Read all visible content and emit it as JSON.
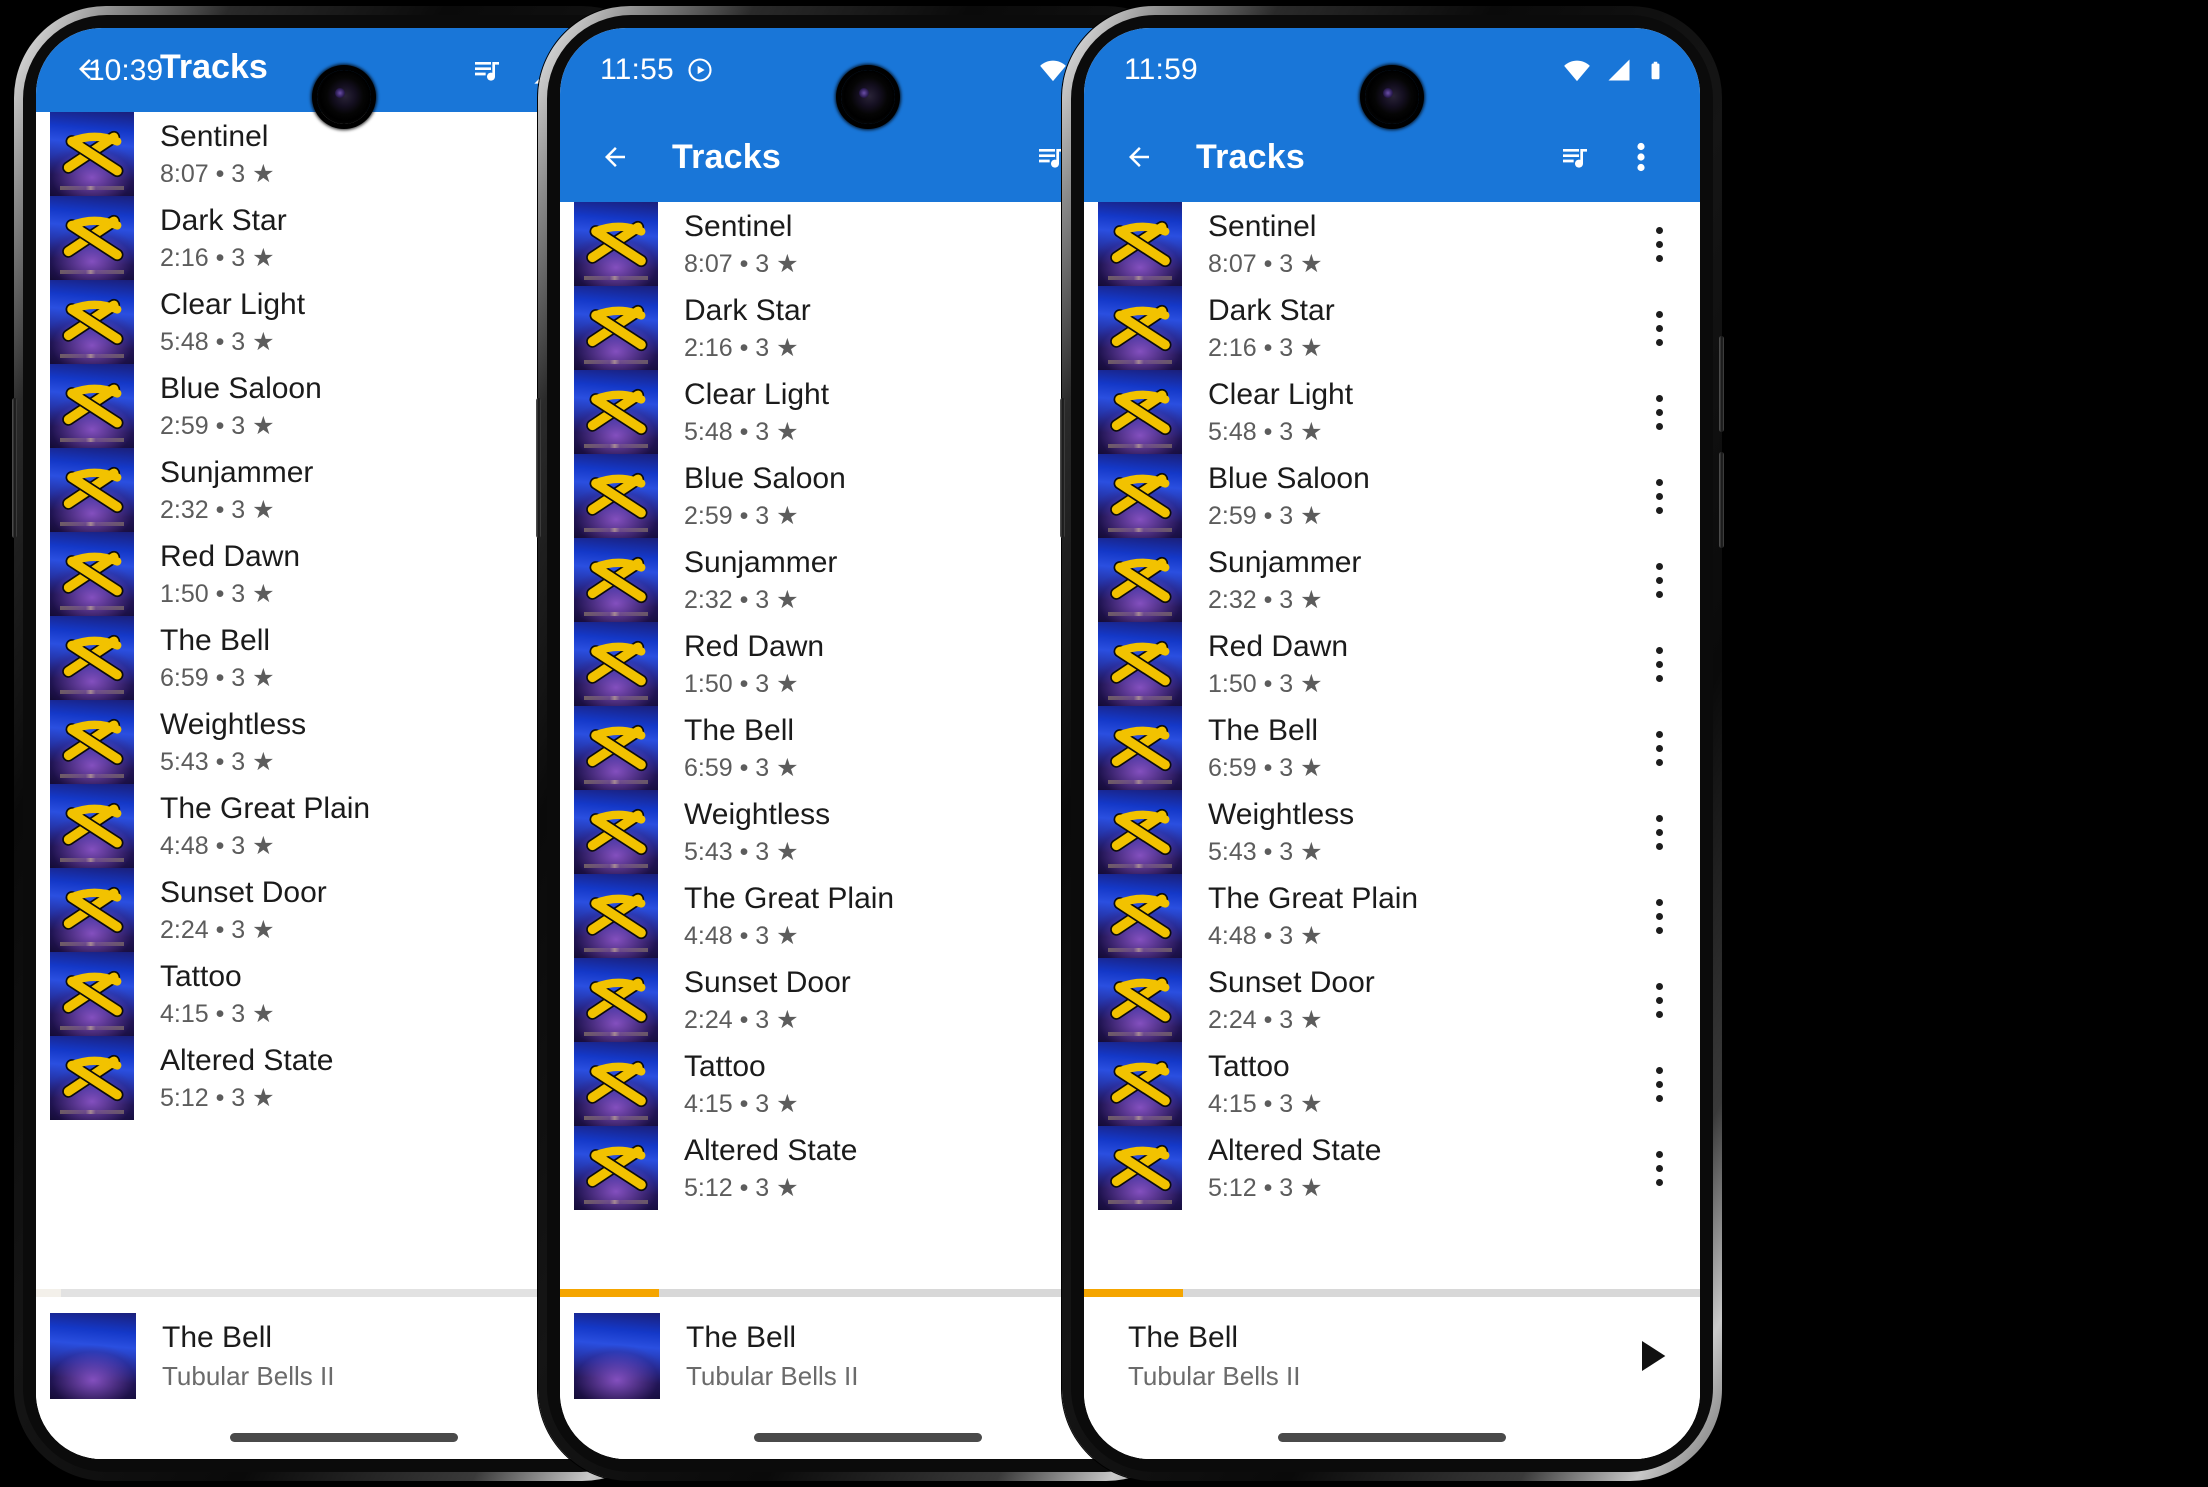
{
  "app": {
    "title": "Tracks",
    "accent_blue": "#1976d8",
    "progress_orange": "#f5a500",
    "album_name": "Tubular Bells II"
  },
  "icons": {
    "back": "arrow-back-icon",
    "queue": "queue-music-icon",
    "overflow": "more-vert-icon",
    "wifi": "wifi-icon",
    "signal": "signal-cellular-icon",
    "battery": "battery-icon",
    "play": "play-arrow-icon",
    "play_circle": "play-circle-outline-icon",
    "camera": "front-camera-punch-hole"
  },
  "tracks": [
    {
      "title": "Sentinel",
      "duration": "8:07",
      "rating": "3"
    },
    {
      "title": "Dark Star",
      "duration": "2:16",
      "rating": "3"
    },
    {
      "title": "Clear Light",
      "duration": "5:48",
      "rating": "3"
    },
    {
      "title": "Blue Saloon",
      "duration": "2:59",
      "rating": "3"
    },
    {
      "title": "Sunjammer",
      "duration": "2:32",
      "rating": "3"
    },
    {
      "title": "Red Dawn",
      "duration": "1:50",
      "rating": "3"
    },
    {
      "title": "The Bell",
      "duration": "6:59",
      "rating": "3"
    },
    {
      "title": "Weightless",
      "duration": "5:43",
      "rating": "3"
    },
    {
      "title": "The Great Plain",
      "duration": "4:48",
      "rating": "3"
    },
    {
      "title": "Sunset Door",
      "duration": "2:24",
      "rating": "3"
    },
    {
      "title": "Tattoo",
      "duration": "4:15",
      "rating": "3"
    },
    {
      "title": "Altered State",
      "duration": "5:12",
      "rating": "3"
    }
  ],
  "separator": "•",
  "star": "★",
  "phones": [
    {
      "id": "phone-1",
      "status_time": "10:39",
      "has_play_circle": false,
      "merged_bar": true,
      "visible_track_count": 12,
      "mini_player": {
        "title": "The Bell",
        "artist": "Tubular Bells II",
        "has_artwork": true,
        "progress_percent": 4,
        "progress_visible": false
      }
    },
    {
      "id": "phone-2",
      "status_time": "11:55",
      "has_play_circle": true,
      "merged_bar": false,
      "visible_track_count": 11,
      "mini_player": {
        "title": "The Bell",
        "artist": "Tubular Bells II",
        "has_artwork": true,
        "progress_percent": 16,
        "progress_visible": true
      }
    },
    {
      "id": "phone-3",
      "status_time": "11:59",
      "has_play_circle": false,
      "merged_bar": false,
      "visible_track_count": 11,
      "mini_player": {
        "title": "The Bell",
        "artist": "Tubular Bells II",
        "has_artwork": false,
        "progress_percent": 16,
        "progress_visible": true
      }
    }
  ]
}
